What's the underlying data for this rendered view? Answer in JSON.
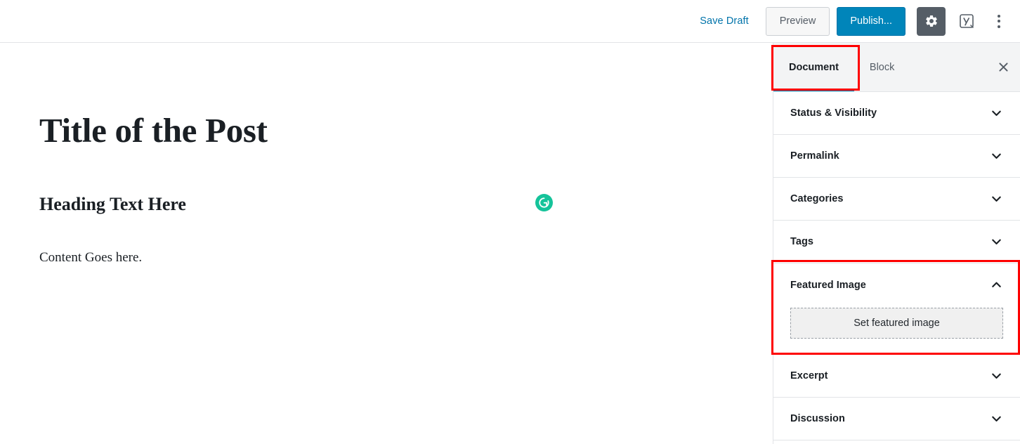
{
  "header": {
    "save_draft_label": "Save Draft",
    "preview_label": "Preview",
    "publish_label": "Publish...",
    "settings_icon": "gear-icon",
    "yoast_icon": "yoast-seo-icon",
    "more_icon": "kebab-menu-icon",
    "publish_color": "#0085ba",
    "gear_bg_color": "#555d66",
    "link_color": "#0073aa"
  },
  "editor": {
    "title": "Title of the Post",
    "heading": "Heading Text Here",
    "paragraph": "Content Goes here.",
    "grammarly_icon": "grammarly-icon",
    "grammarly_color": "#15c39a"
  },
  "sidebar": {
    "tabs": [
      {
        "label": "Document",
        "active": true
      },
      {
        "label": "Block",
        "active": false
      }
    ],
    "close_label": "×",
    "active_tab_underline_color": "#0085ba",
    "panels": [
      {
        "label": "Status & Visibility",
        "expanded": false,
        "chevron": "chevron-down-icon"
      },
      {
        "label": "Permalink",
        "expanded": false,
        "chevron": "chevron-down-icon"
      },
      {
        "label": "Categories",
        "expanded": false,
        "chevron": "chevron-down-icon"
      },
      {
        "label": "Tags",
        "expanded": false,
        "chevron": "chevron-down-icon"
      }
    ],
    "featured_image": {
      "label": "Featured Image",
      "expanded": true,
      "chevron": "chevron-up-icon",
      "button_label": "Set featured image"
    },
    "panels_bottom": [
      {
        "label": "Excerpt",
        "expanded": false,
        "chevron": "chevron-down-icon"
      },
      {
        "label": "Discussion",
        "expanded": false,
        "chevron": "chevron-down-icon"
      }
    ]
  },
  "annotations": {
    "color": "#fe0000",
    "boxes": [
      {
        "target": "Document"
      },
      {
        "target": "Featured Image"
      }
    ]
  }
}
